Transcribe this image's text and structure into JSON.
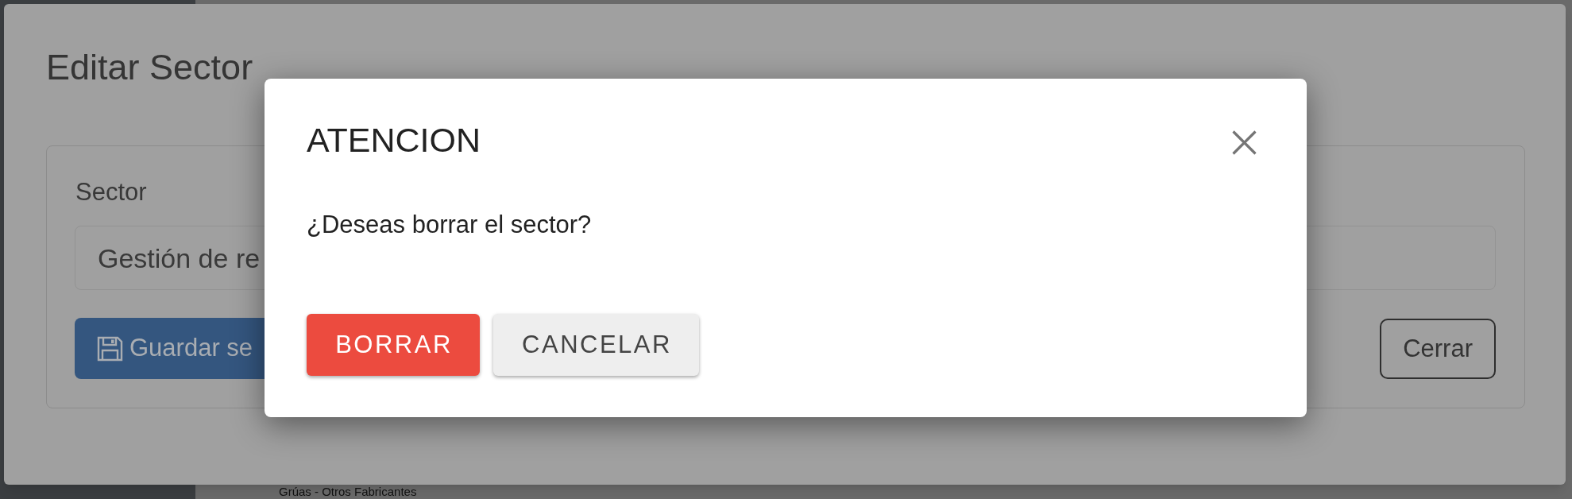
{
  "page": {
    "list_item": "Grúas - Otros Fabricantes"
  },
  "edit_modal": {
    "title": "Editar Sector",
    "field": {
      "label": "Sector",
      "value": "Gestión de re"
    },
    "save_button": {
      "label": "Guardar se"
    },
    "close_button": {
      "label": "Cerrar"
    }
  },
  "confirm_dialog": {
    "title": "ATENCION",
    "message": "¿Deseas borrar el sector?",
    "buttons": [
      {
        "label": "BORRAR",
        "kind": "primary"
      },
      {
        "label": "CANCELAR",
        "kind": "secondary"
      }
    ]
  }
}
